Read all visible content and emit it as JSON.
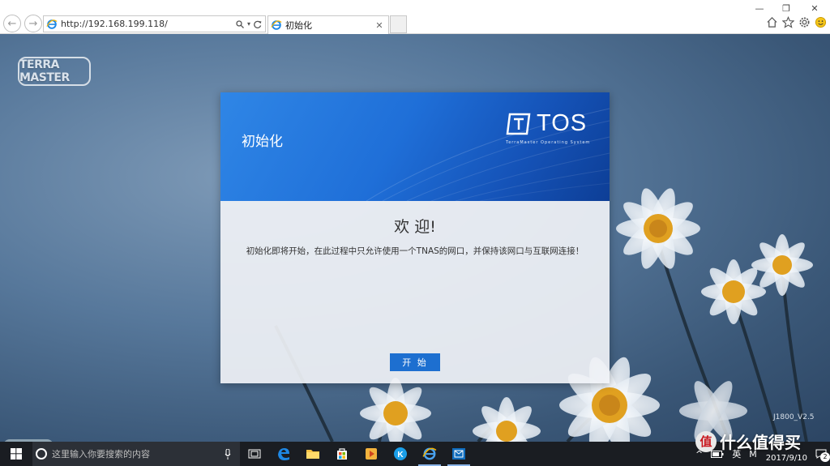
{
  "browser": {
    "address_url": "http://192.168.199.118/",
    "tab_title": "初始化",
    "search_icon": "search-icon",
    "dropdown_icon": "chevron-down-icon",
    "refresh_icon": "refresh-icon"
  },
  "page": {
    "brand_logo": "TERRA MASTER",
    "version": "J1800_V2.5"
  },
  "dialog": {
    "header_title": "初始化",
    "tos_logo_text": "TOS",
    "tos_subtitle": "TerraMaster Operating System",
    "welcome": "欢 迎!",
    "message": "初始化即将开始，在此过程中只允许使用一个TNAS的网口，并保持该网口与互联网连接！",
    "start_button": "开 始",
    "accent_color": "#1d6fd0"
  },
  "taskbar": {
    "search_placeholder": "这里输入你要搜索的内容",
    "ime_label": "英",
    "ime_mode": "M",
    "date": "2017/9/10",
    "notifications_count": "2"
  },
  "watermark": {
    "badge_text": "值",
    "text": "什么值得买"
  }
}
